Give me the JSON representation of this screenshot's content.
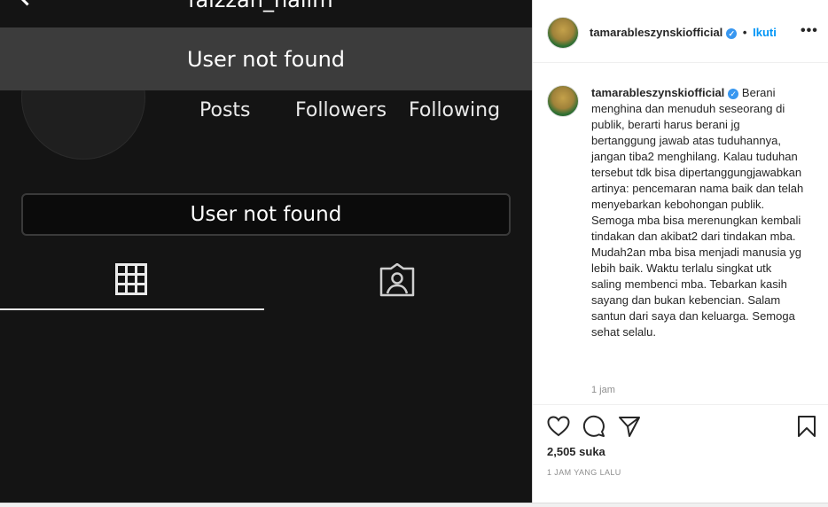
{
  "left_panel": {
    "username": "faizzan_halim",
    "banner_text": "User not found",
    "stats": {
      "posts": "Posts",
      "followers": "Followers",
      "following": "Following"
    },
    "button_text": "User not found",
    "tabs": [
      "grid-icon",
      "tagged-icon"
    ]
  },
  "post": {
    "account": "tamarableszynskiofficial",
    "separator": "•",
    "follow_label": "Ikuti",
    "more_label": "•••",
    "caption_user": "tamarableszynskiofficial",
    "caption_text": "Berani menghina dan menuduh seseorang di publik, berarti harus berani jg bertanggung jawab atas tuduhannya, jangan tiba2 menghilang. Kalau tuduhan tersebut tdk bisa dipertanggungjawabkan artinya: pencemaran nama baik dan telah menyebarkan kebohongan publik. Semoga mba bisa merenungkan kembali tindakan dan akibat2 dari tindakan mba. Mudah2an mba bisa menjadi manusia yg lebih baik. Waktu terlalu singkat utk saling membenci mba. Tebarkan kasih sayang dan bukan kebencian. Salam santun dari saya dan keluarga. Semoga sehat selalu.",
    "caption_time": "1 jam",
    "likes": "2,505 suka",
    "posted_ago": "1 JAM YANG LALU"
  },
  "colors": {
    "follow": "#0095f6",
    "verified": "#3897f0",
    "dark_bg": "#141414"
  }
}
